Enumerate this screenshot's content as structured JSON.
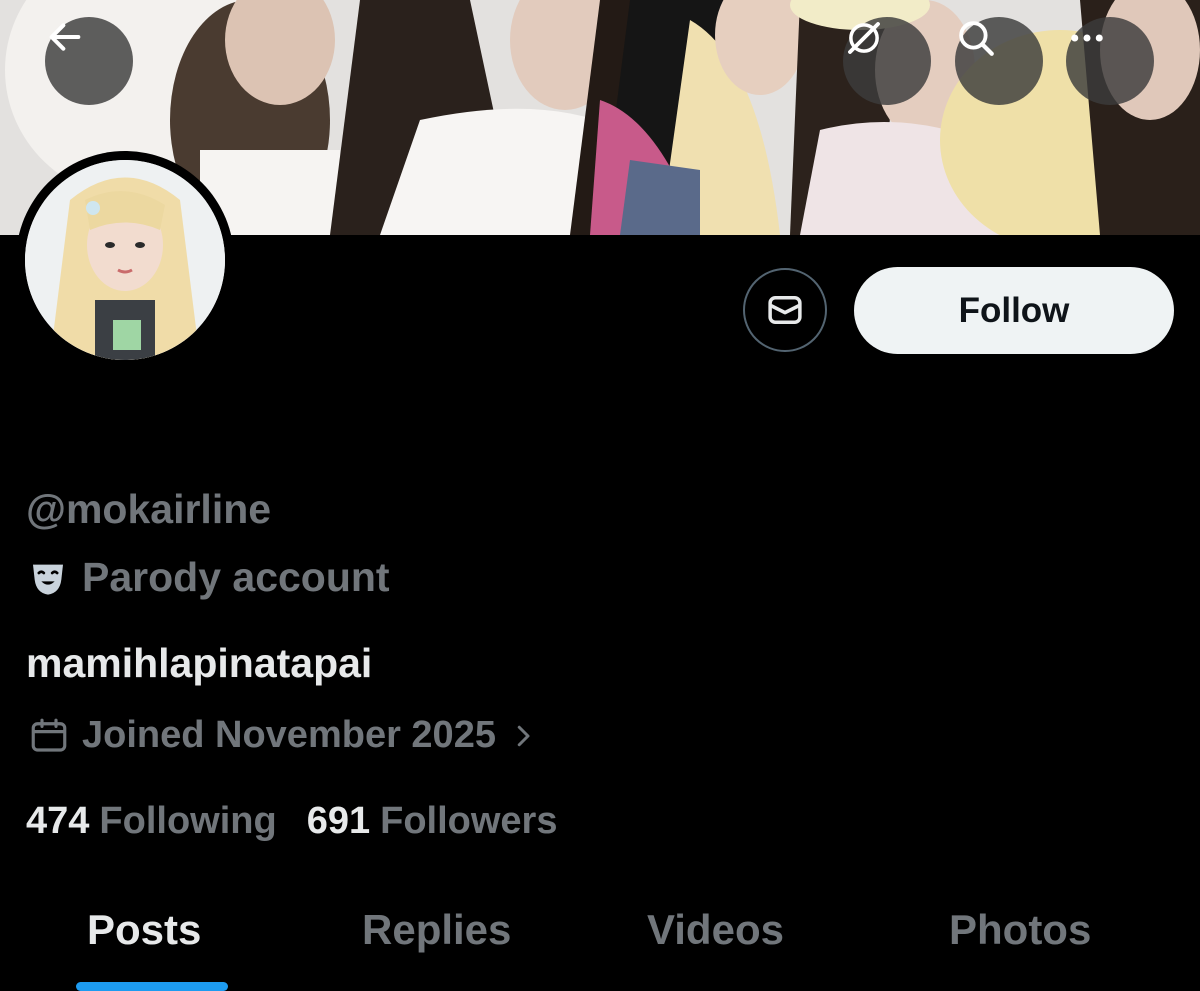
{
  "header": {
    "back_icon": "arrow-left-icon",
    "grok_icon": "grok-icon",
    "search_icon": "search-icon",
    "more_icon": "more-horizontal-icon"
  },
  "profile": {
    "handle": "@mokairline",
    "parody_label": "Parody account",
    "bio": "mamihlapinatapai",
    "joined": "Joined November 2025",
    "following_count": "474",
    "following_label": "Following",
    "followers_count": "691",
    "followers_label": "Followers"
  },
  "actions": {
    "message_icon": "envelope-icon",
    "follow_label": "Follow"
  },
  "tabs": [
    {
      "label": "Posts",
      "active": true
    },
    {
      "label": "Replies",
      "active": false
    },
    {
      "label": "Videos",
      "active": false
    },
    {
      "label": "Photos",
      "active": false
    }
  ],
  "colors": {
    "background": "#000000",
    "primary_text": "#e7e9ea",
    "secondary_text": "#71767b",
    "accent": "#1d9bf0",
    "follow_button_bg": "#eff3f4"
  }
}
